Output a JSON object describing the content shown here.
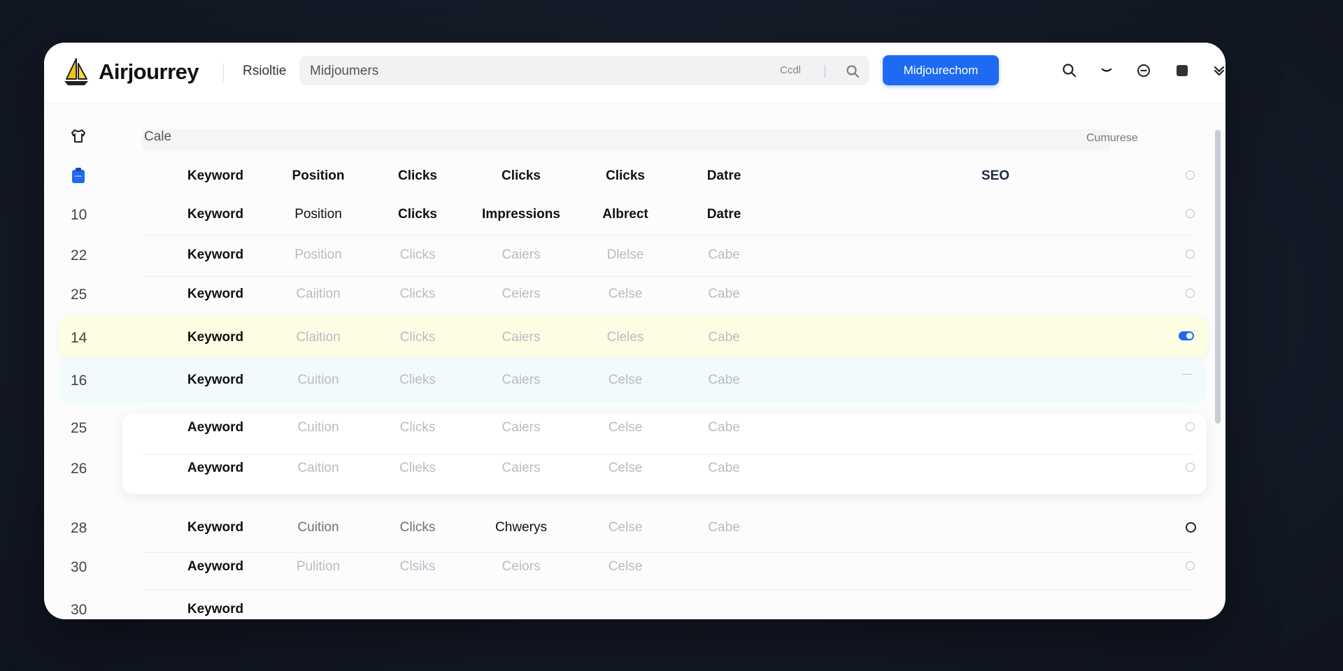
{
  "app": {
    "brand": "Airjourrey",
    "nav_label": "Rsioltie"
  },
  "search": {
    "value": "Midjoumers",
    "hint": "Ccdl"
  },
  "toolbar": {
    "primary_button": "Midjourechom"
  },
  "filter": {
    "placeholder": "Cale",
    "right_label": "Cumurese"
  },
  "table": {
    "seo_label": "SEO",
    "header": [
      "Keyword",
      "Position",
      "Clicks",
      "Clicks",
      "Clicks",
      "Datre"
    ],
    "rows": [
      {
        "num": "10",
        "cells": [
          "Keyword",
          "Position",
          "Clicks",
          "Impressions",
          "Albrect",
          "Datre"
        ]
      },
      {
        "num": "22",
        "cells": [
          "Keyword",
          "Position",
          "Clicks",
          "Caiers",
          "Dlelse",
          "Cabe"
        ]
      },
      {
        "num": "25",
        "cells": [
          "Keyword",
          "Caiition",
          "Clicks",
          "Ceiers",
          "Celse",
          "Cabe"
        ]
      },
      {
        "num": "14",
        "cells": [
          "Keyword",
          "Claition",
          "Clicks",
          "Caiers",
          "Cleles",
          "Cabe"
        ]
      },
      {
        "num": "16",
        "cells": [
          "Keyword",
          "Cuition",
          "Clieks",
          "Caiers",
          "Celse",
          "Cabe"
        ]
      },
      {
        "num": "25",
        "cells": [
          "Aeyword",
          "Cuition",
          "Clicks",
          "Caiers",
          "Celse",
          "Cabe"
        ]
      },
      {
        "num": "26",
        "cells": [
          "Aeyword",
          "Caition",
          "Clieks",
          "Caiers",
          "Celse",
          "Cabe"
        ]
      },
      {
        "num": "28",
        "cells": [
          "Keyword",
          "Cuition",
          "Clicks",
          "Chwerys",
          "Celse",
          "Cabe"
        ]
      },
      {
        "num": "30",
        "cells": [
          "Aeyword",
          "Pulition",
          "Clsiks",
          "Ceiors",
          "Celse",
          ""
        ]
      },
      {
        "num": "30",
        "cells": [
          "Keyword",
          "",
          "",
          "",
          "",
          ""
        ]
      }
    ]
  },
  "colors": {
    "accent": "#1f6af2",
    "highlight_row": "#fdfde4",
    "hover_row": "#f1fbfd"
  },
  "icons": [
    "sailboat-logo-icon",
    "search-icon",
    "chevron-down-icon",
    "minus-circle-icon",
    "square-icon",
    "double-chevron-down-icon",
    "shirt-icon",
    "clipboard-icon"
  ]
}
